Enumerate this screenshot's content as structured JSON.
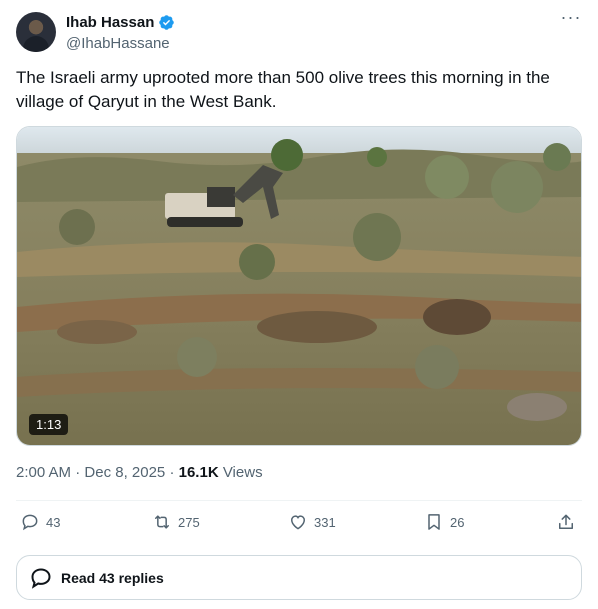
{
  "author": {
    "name": "Ihab Hassan",
    "handle": "@IhabHassane"
  },
  "tweet": {
    "text": "The Israeli army uprooted more than 500 olive trees this morning in the village of Qaryut in the West Bank."
  },
  "media": {
    "duration": "1:13"
  },
  "meta": {
    "time": "2:00 AM",
    "date": "Dec 8, 2025",
    "views_count": "16.1K",
    "views_label": "Views"
  },
  "actions": {
    "replies": "43",
    "reposts": "275",
    "likes": "331",
    "bookmarks": "26"
  },
  "read_replies": "Read 43 replies",
  "colors": {
    "verified": "#1d9bf0",
    "muted": "#536471"
  }
}
